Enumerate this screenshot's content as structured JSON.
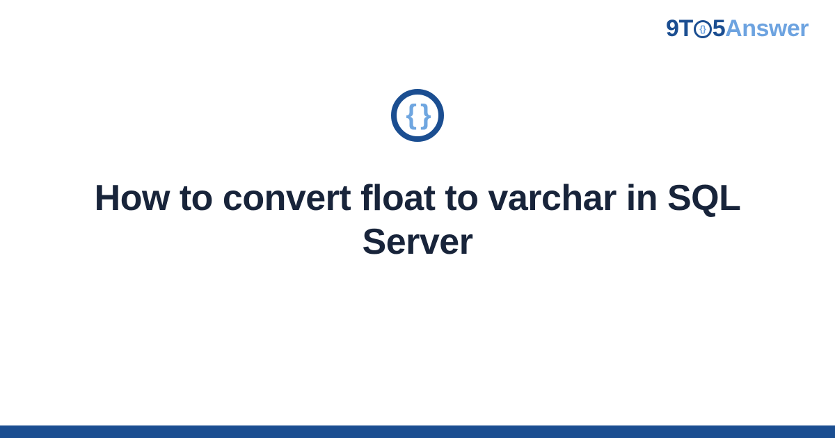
{
  "brand": {
    "nine": "9",
    "t": "T",
    "o_inner": "{}",
    "five": "5",
    "answer": "Answer"
  },
  "icon": {
    "braces": "{ }"
  },
  "title": "How to convert float to varchar in SQL Server",
  "colors": {
    "primary": "#1b4e91",
    "accent": "#6fa6e0",
    "text": "#18243a"
  }
}
